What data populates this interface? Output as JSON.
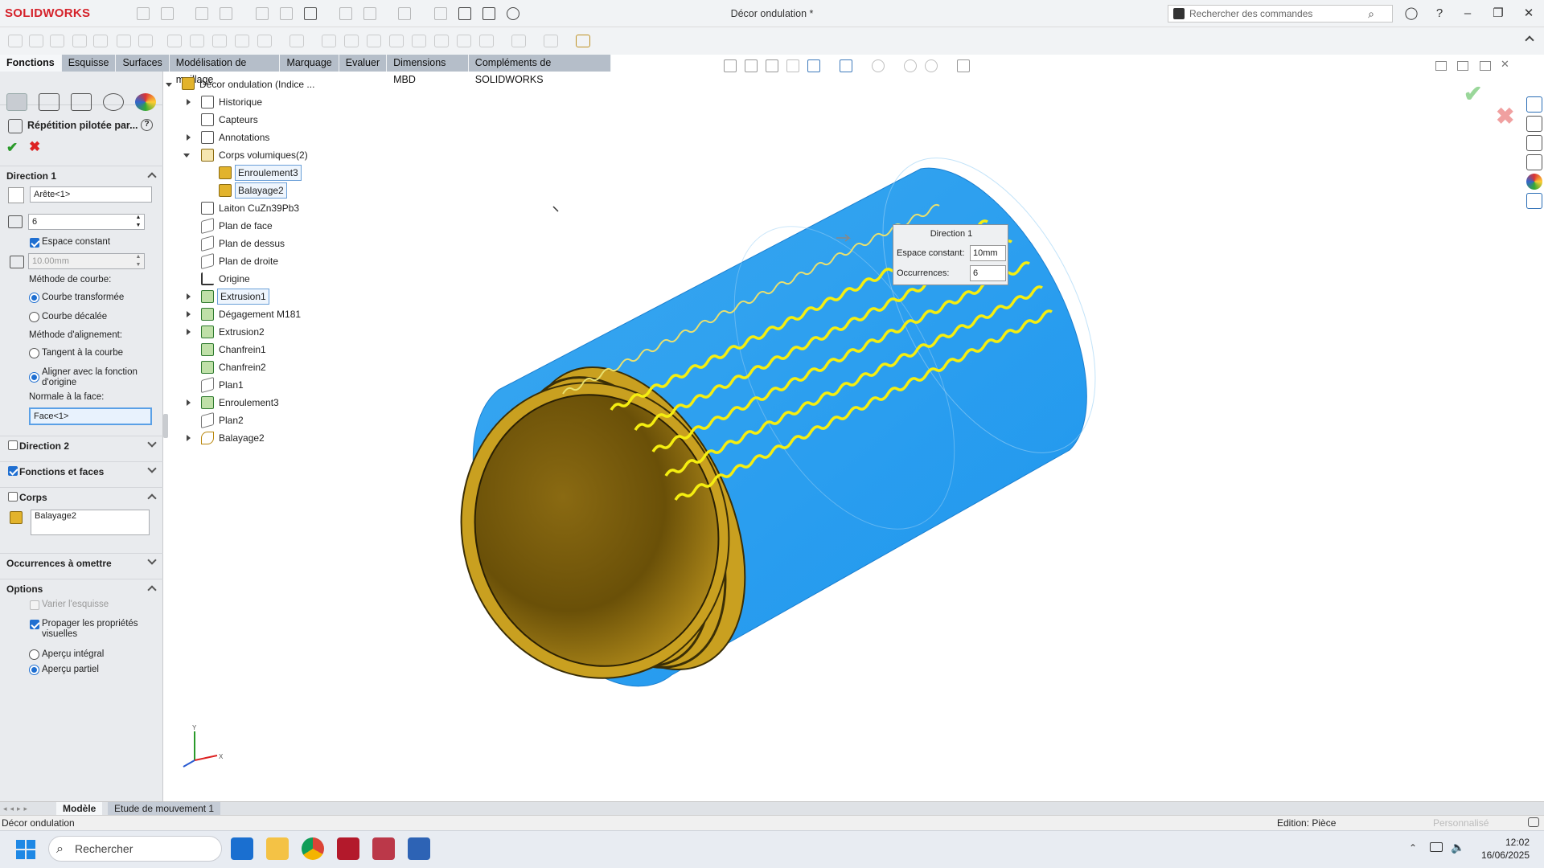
{
  "app": {
    "brand": "SOLIDWORKS",
    "document_title": "Décor ondulation *"
  },
  "search": {
    "placeholder": "Rechercher des commandes"
  },
  "tabs": [
    "Fonctions",
    "Esquisse",
    "Surfaces",
    "Modélisation de maillage",
    "Marquage",
    "Evaluer",
    "Dimensions MBD",
    "Compléments de SOLIDWORKS"
  ],
  "property_manager": {
    "title": "Répétition pilotée par...",
    "direction1": {
      "header": "Direction 1",
      "edge": "Arête<1>",
      "count": "6",
      "constant_spacing_label": "Espace constant",
      "spacing": "10.00mm",
      "curve_method_label": "Méthode de courbe:",
      "curve_transformed": "Courbe transformée",
      "curve_offset": "Courbe décalée",
      "align_method_label": "Méthode d'alignement:",
      "tangent": "Tangent à la courbe",
      "align_origin": "Aligner avec la fonction d'origine",
      "normal_face_label": "Normale à la face:",
      "face": "Face<1>"
    },
    "direction2": "Direction 2",
    "features_faces": "Fonctions et faces",
    "bodies": {
      "header": "Corps",
      "item": "Balayage2"
    },
    "skip": "Occurrences à omettre",
    "options": {
      "header": "Options",
      "vary_sketch": "Varier l'esquisse",
      "propagate": "Propager les propriétés visuelles",
      "full_preview": "Aperçu intégral",
      "partial_preview": "Aperçu partiel"
    }
  },
  "tree": {
    "root": "Décor ondulation (Indice ...",
    "items": [
      "Historique",
      "Capteurs",
      "Annotations",
      "Corps volumiques(2)",
      "Enroulement3",
      "Balayage2",
      "Laiton CuZn39Pb3",
      "Plan de face",
      "Plan de dessus",
      "Plan de droite",
      "Origine",
      "Extrusion1",
      "Dégagement M181",
      "Extrusion2",
      "Chanfrein1",
      "Chanfrein2",
      "Plan1",
      "Enroulement3",
      "Plan2",
      "Balayage2"
    ]
  },
  "popup": {
    "title": "Direction 1",
    "spacing_label": "Espace constant:",
    "spacing_value": "10mm",
    "count_label": "Occurrences:",
    "count_value": "6"
  },
  "bottom_tabs": [
    "Modèle",
    "Etude de mouvement 1"
  ],
  "status": {
    "left": "Décor ondulation",
    "edition": "Edition: Pièce",
    "custom": "Personnalisé"
  },
  "taskbar": {
    "search": "Rechercher",
    "time": "12:02",
    "date": "16/06/2025"
  },
  "triad": {
    "y": "Y",
    "x": "X"
  }
}
